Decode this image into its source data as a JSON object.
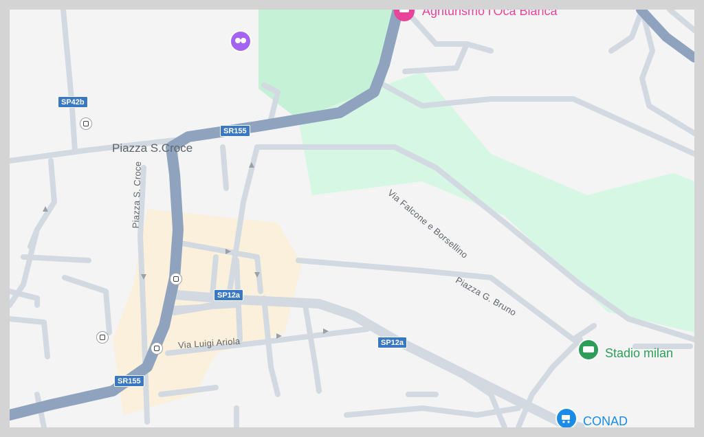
{
  "colors": {
    "road_major": "#8fa3bf",
    "road_minor": "#d2d9e1",
    "park": "#c5f2d7",
    "park_light": "#d9f7e5",
    "urban": "#faf0dc",
    "shield": "#3a78c4",
    "food_poi": "#e8449a",
    "attraction_poi": "#a463f2",
    "sport_poi": "#2e9d5a",
    "shop_poi": "#1a8ce8"
  },
  "route_shields": [
    {
      "id": "sp42b",
      "label": "SP42b"
    },
    {
      "id": "sr155-north",
      "label": "SR155"
    },
    {
      "id": "sp12a-west",
      "label": "SP12a"
    },
    {
      "id": "sp12a-east",
      "label": "SP12a"
    },
    {
      "id": "sr155-south",
      "label": "SR155"
    }
  ],
  "streets": {
    "piazza_s_croce": "Piazza S.Croce",
    "piazza_s_croce_vertical": "Piazza S. Croce",
    "via_falcone": "Via Falcone e Borsellino",
    "piazza_g_bruno": "Piazza G. Bruno",
    "via_luigi_ariola": "Via Luigi Ariola"
  },
  "pois": [
    {
      "id": "agriturismo",
      "label": "Agriturismo l'Oca Bianca",
      "icon": "restaurant-icon",
      "color": "#e8449a"
    },
    {
      "id": "stadio",
      "label": "Stadio milan",
      "icon": "stadium-icon",
      "color": "#2e9d5a"
    },
    {
      "id": "conad",
      "label": "CONAD",
      "icon": "shopping-cart-icon",
      "color": "#1a8ce8"
    },
    {
      "id": "attraction",
      "label": "",
      "icon": "attraction-icon",
      "color": "#a463f2"
    }
  ],
  "bus_stops": [
    "bus-stop-icon",
    "bus-stop-icon",
    "bus-stop-icon",
    "bus-stop-icon"
  ]
}
